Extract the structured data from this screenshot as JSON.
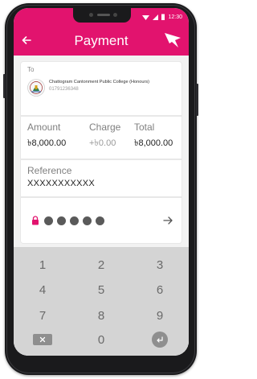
{
  "status_bar": {
    "time": "12:30"
  },
  "header": {
    "title": "Payment",
    "background_color": "#e2136e",
    "back_icon": "arrow-left-icon",
    "brand_icon": "bird-logo-icon"
  },
  "recipient": {
    "to_label": "To",
    "name": "Chattogram Cantonment Public College (Honours)",
    "account_number": "01791236348",
    "avatar_icon": "college-emblem-icon"
  },
  "amounts": {
    "amount_label": "Amount",
    "amount_value": "৳8,000.00",
    "charge_label": "Charge",
    "charge_value": "+৳0.00",
    "total_label": "Total",
    "total_value": "৳8,000.00"
  },
  "reference": {
    "label": "Reference",
    "value": "XXXXXXXXXXX"
  },
  "pin": {
    "dots_count": 5,
    "lock_icon": "lock-icon",
    "next_icon": "arrow-right-icon"
  },
  "keypad": {
    "keys": [
      "1",
      "2",
      "3",
      "4",
      "5",
      "6",
      "7",
      "8",
      "9",
      "0"
    ],
    "delete_icon": "backspace-icon",
    "enter_icon": "enter-icon"
  }
}
